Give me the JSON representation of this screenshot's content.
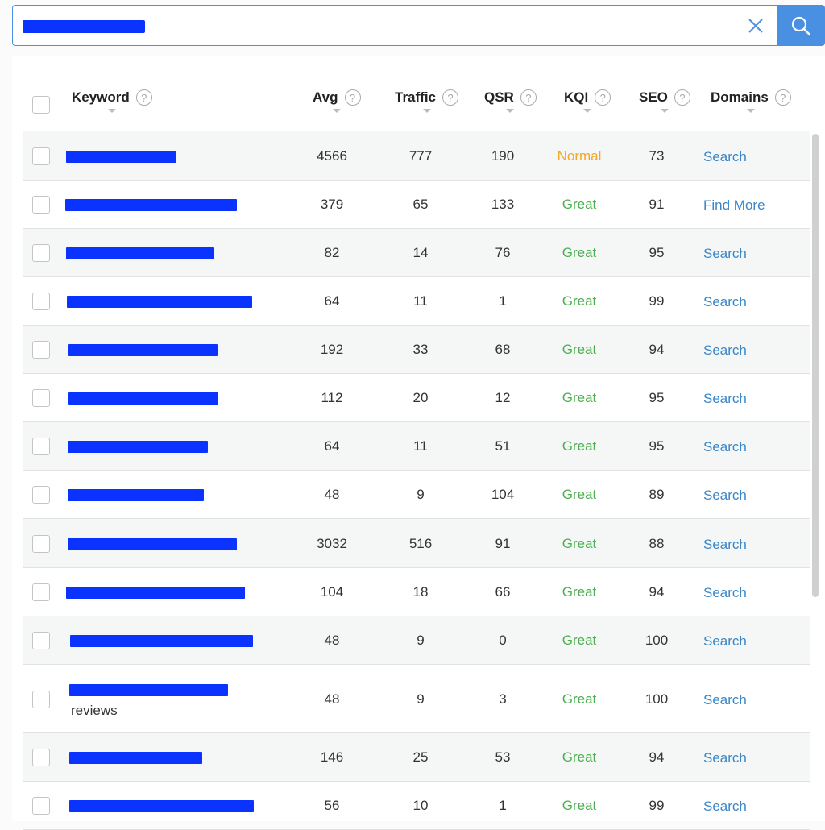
{
  "search": {
    "value": "",
    "placeholder": ""
  },
  "columns": [
    {
      "key": "keyword",
      "label": "Keyword",
      "help": "?"
    },
    {
      "key": "avg",
      "label": "Avg",
      "help": "?"
    },
    {
      "key": "traffic",
      "label": "Traffic",
      "help": "?"
    },
    {
      "key": "qsr",
      "label": "QSR",
      "help": "?"
    },
    {
      "key": "kqi",
      "label": "KQI",
      "help": "?"
    },
    {
      "key": "seo",
      "label": "SEO",
      "help": "?"
    },
    {
      "key": "domains",
      "label": "Domains",
      "help": "?"
    }
  ],
  "rows": [
    {
      "keyword": "",
      "extra": "",
      "avg": "4566",
      "traffic": "777",
      "qsr": "190",
      "kqi": "Normal",
      "seo": "73",
      "domains": "Search"
    },
    {
      "keyword": "",
      "extra": "",
      "avg": "379",
      "traffic": "65",
      "qsr": "133",
      "kqi": "Great",
      "seo": "91",
      "domains": "Find More"
    },
    {
      "keyword": "",
      "extra": "",
      "avg": "82",
      "traffic": "14",
      "qsr": "76",
      "kqi": "Great",
      "seo": "95",
      "domains": "Search"
    },
    {
      "keyword": "",
      "extra": "",
      "avg": "64",
      "traffic": "11",
      "qsr": "1",
      "kqi": "Great",
      "seo": "99",
      "domains": "Search"
    },
    {
      "keyword": "",
      "extra": "",
      "avg": "192",
      "traffic": "33",
      "qsr": "68",
      "kqi": "Great",
      "seo": "94",
      "domains": "Search"
    },
    {
      "keyword": "",
      "extra": "",
      "avg": "112",
      "traffic": "20",
      "qsr": "12",
      "kqi": "Great",
      "seo": "95",
      "domains": "Search"
    },
    {
      "keyword": "",
      "extra": "",
      "avg": "64",
      "traffic": "11",
      "qsr": "51",
      "kqi": "Great",
      "seo": "95",
      "domains": "Search"
    },
    {
      "keyword": "",
      "extra": "",
      "avg": "48",
      "traffic": "9",
      "qsr": "104",
      "kqi": "Great",
      "seo": "89",
      "domains": "Search"
    },
    {
      "keyword": "",
      "extra": "",
      "avg": "3032",
      "traffic": "516",
      "qsr": "91",
      "kqi": "Great",
      "seo": "88",
      "domains": "Search"
    },
    {
      "keyword": "",
      "extra": "",
      "avg": "104",
      "traffic": "18",
      "qsr": "66",
      "kqi": "Great",
      "seo": "94",
      "domains": "Search"
    },
    {
      "keyword": "",
      "extra": "",
      "avg": "48",
      "traffic": "9",
      "qsr": "0",
      "kqi": "Great",
      "seo": "100",
      "domains": "Search"
    },
    {
      "keyword": "",
      "extra": "reviews",
      "avg": "48",
      "traffic": "9",
      "qsr": "3",
      "kqi": "Great",
      "seo": "100",
      "domains": "Search"
    },
    {
      "keyword": "",
      "extra": "",
      "avg": "146",
      "traffic": "25",
      "qsr": "53",
      "kqi": "Great",
      "seo": "94",
      "domains": "Search"
    },
    {
      "keyword": "",
      "extra": "",
      "avg": "56",
      "traffic": "10",
      "qsr": "1",
      "kqi": "Great",
      "seo": "99",
      "domains": "Search"
    }
  ],
  "icons": {
    "clear": "close-icon",
    "search": "search-icon",
    "help": "help-circle-icon",
    "sort": "caret-down-icon"
  },
  "colors": {
    "accent": "#4a90e2",
    "great": "#4caf50",
    "normal": "#f5a623",
    "link": "#3b86c7",
    "redaction": "#0a33ff"
  }
}
